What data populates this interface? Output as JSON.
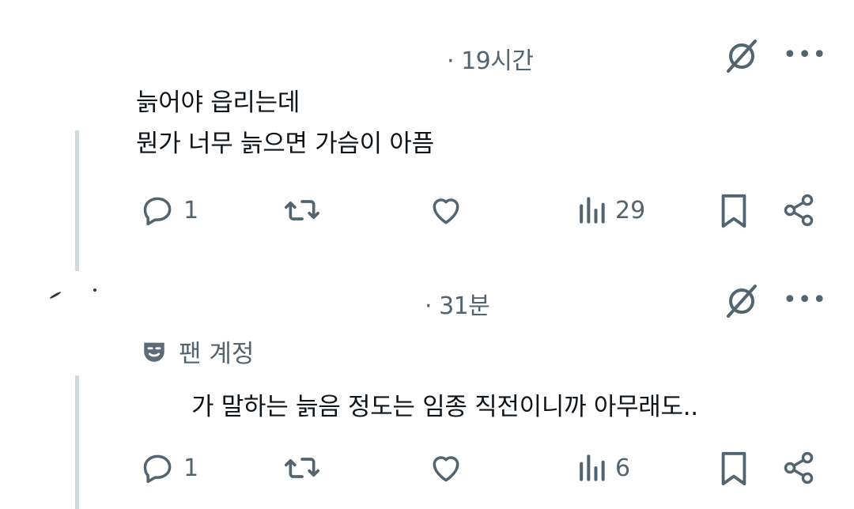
{
  "posts": [
    {
      "time": "· 19시간",
      "lines": [
        "늙어야 읍리는데",
        "뭔가 너무 늙으면 가슴이 아픔"
      ],
      "fan_label": "",
      "actions": {
        "replies": "1",
        "reposts": "",
        "likes": "",
        "views": "29"
      }
    },
    {
      "time": "· 31분",
      "lines": [
        "가 말하는 늙음 정도는 임종 직전이니까 아무래도.."
      ],
      "fan_label": "팬 계정",
      "actions": {
        "replies": "1",
        "reposts": "",
        "likes": "",
        "views": "6"
      }
    }
  ],
  "icons": {
    "reply": "reply-icon",
    "repost": "repost-icon",
    "like": "heart-icon",
    "views": "views-icon",
    "bookmark": "bookmark-icon",
    "share": "share-icon",
    "grok": "grok-icon",
    "more": "more-icon",
    "fan": "mask-icon"
  },
  "colors": {
    "muted": "#536471",
    "text": "#0f1419",
    "thread": "#cfd9de"
  }
}
